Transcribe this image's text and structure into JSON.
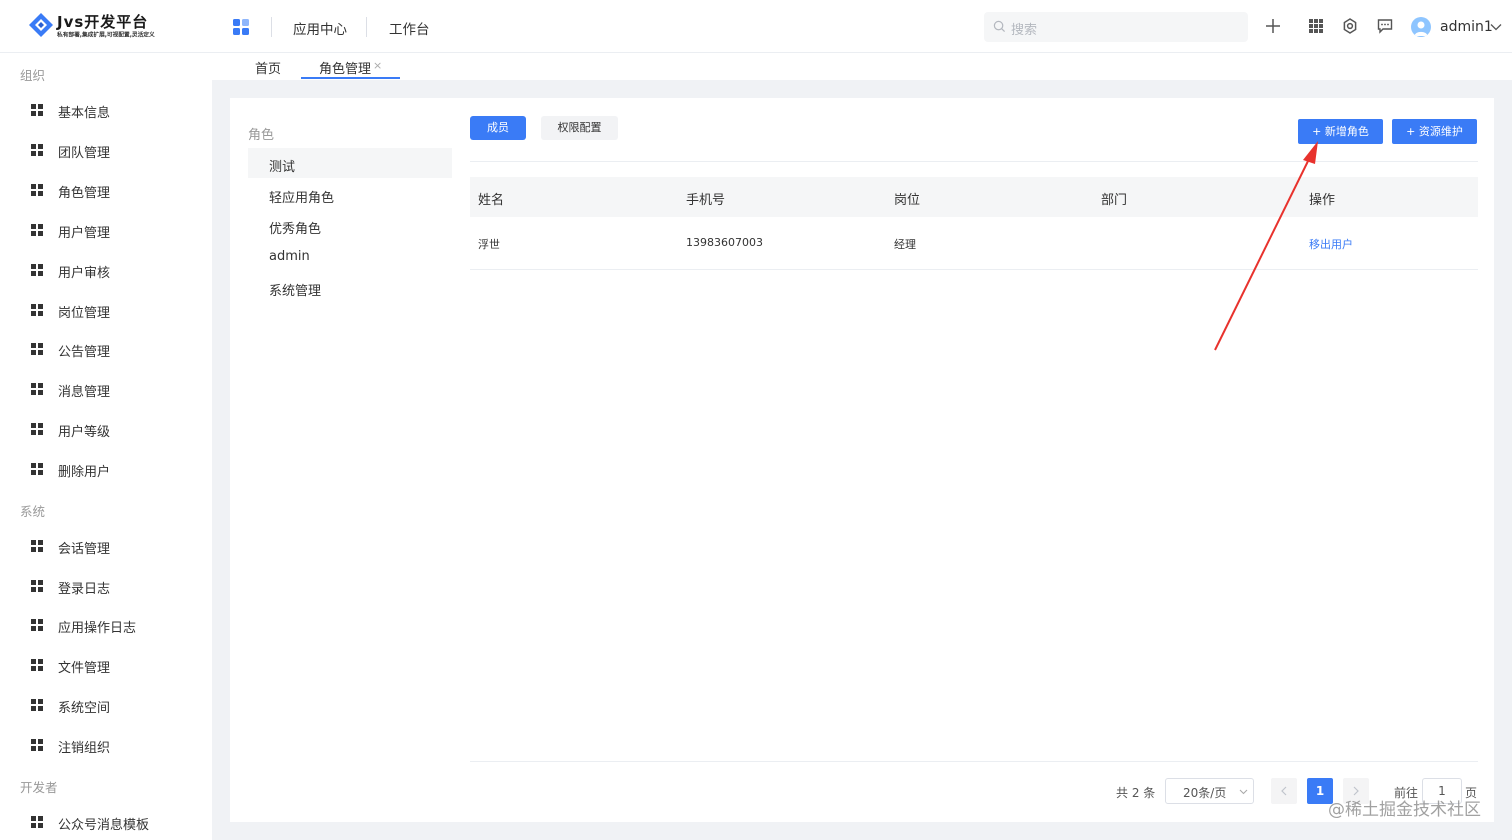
{
  "app": {
    "title": "Jvs开发平台",
    "subtitle": "私有部署,集成扩展,可视配置,灵活定义"
  },
  "header": {
    "nav": [
      "应用中心",
      "工作台"
    ],
    "search_placeholder": "搜索",
    "icons": [
      "plus-icon",
      "apps-grid-icon",
      "settings-icon",
      "message-icon"
    ],
    "username": "admin1"
  },
  "sidebar": {
    "groups": [
      {
        "label": "组织",
        "items": [
          "基本信息",
          "团队管理",
          "角色管理",
          "用户管理",
          "用户审核",
          "岗位管理",
          "公告管理",
          "消息管理",
          "用户等级",
          "删除用户"
        ]
      },
      {
        "label": "系统",
        "items": [
          "会话管理",
          "登录日志",
          "应用操作日志",
          "文件管理",
          "系统空间",
          "注销组织"
        ]
      },
      {
        "label": "开发者",
        "items": [
          "公众号消息模板"
        ]
      }
    ]
  },
  "tabs": {
    "items": [
      "首页",
      "角色管理"
    ],
    "close": "×"
  },
  "roles": {
    "title": "角色",
    "items": [
      "测试",
      "轻应用角色",
      "优秀角色",
      "admin",
      "系统管理"
    ],
    "active_index": 0
  },
  "toolbar": {
    "members": "成员",
    "permissions": "权限配置",
    "add_role": "+ 新增角色",
    "resources": "+ 资源维护"
  },
  "table": {
    "columns": [
      "姓名",
      "手机号",
      "岗位",
      "部门",
      "操作"
    ],
    "rows": [
      {
        "name": "浮世",
        "phone": "13983607003",
        "position": "经理",
        "department": "",
        "action": "移出用户"
      }
    ]
  },
  "pagination": {
    "total": "共 2 条",
    "page_size": "20条/页",
    "current": "1",
    "goto": "前往",
    "goto_value": "1",
    "page_unit": "页"
  },
  "watermark": "@稀土掘金技术社区",
  "colors": {
    "primary": "#3a7bf6",
    "annotation_arrow": "#e8322d"
  }
}
